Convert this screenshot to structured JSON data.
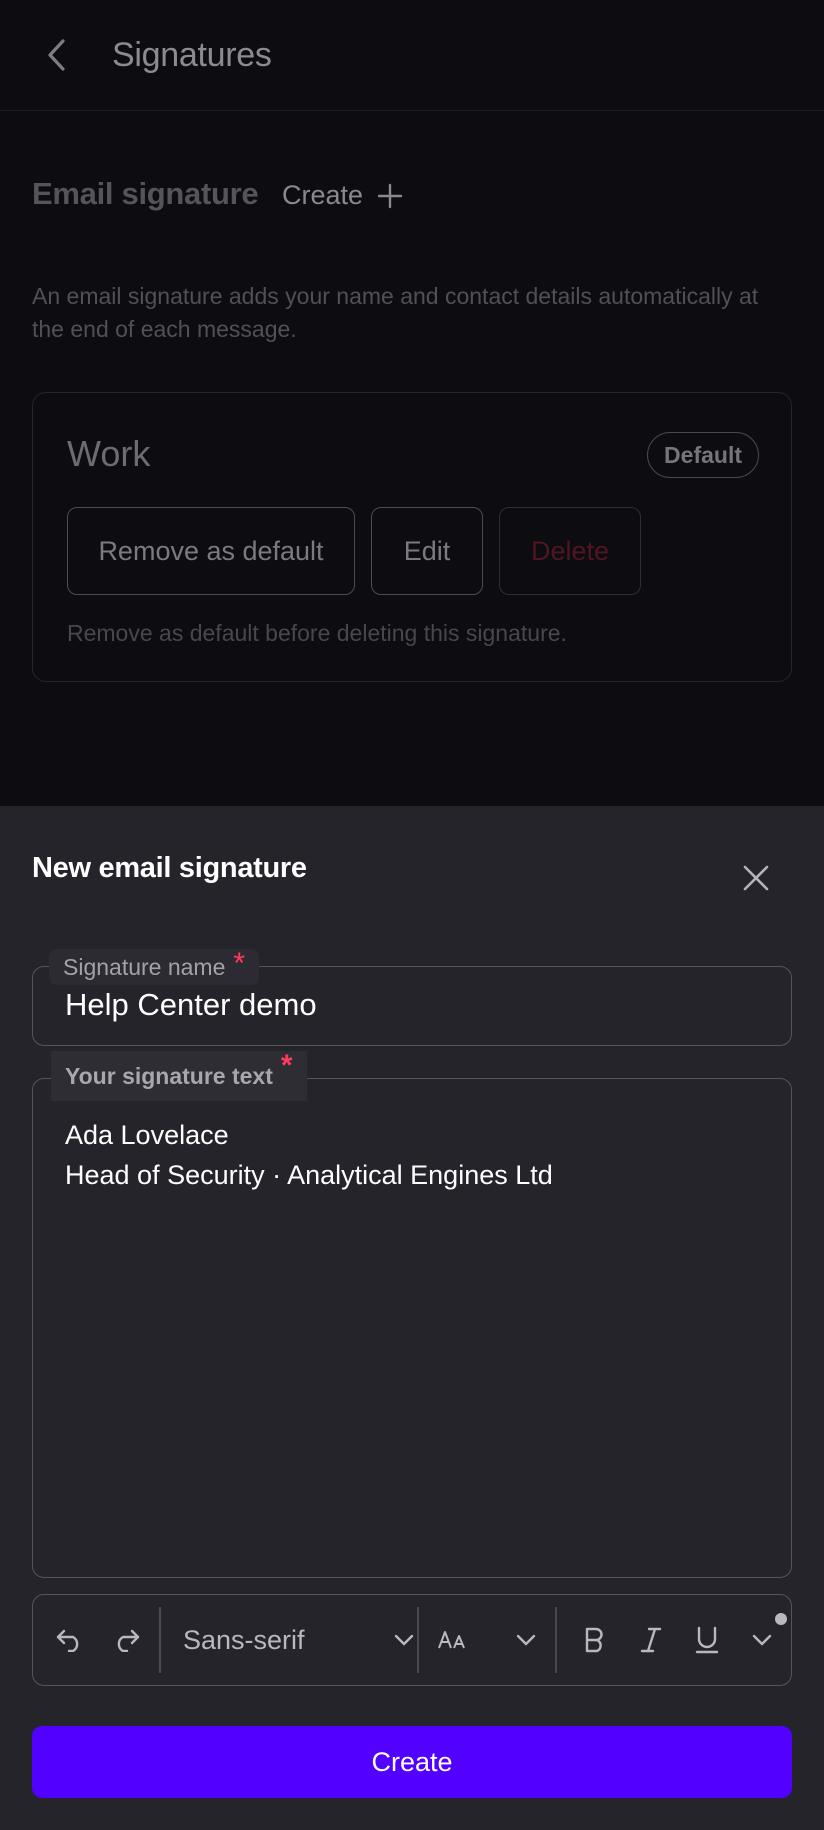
{
  "header": {
    "title": "Signatures"
  },
  "section": {
    "title": "Email signature",
    "create_label": "Create",
    "description": "An email signature adds your name and contact details automatically at the end of each message."
  },
  "signature_card": {
    "name": "Work",
    "badge": "Default",
    "remove_default_label": "Remove as default",
    "edit_label": "Edit",
    "delete_label": "Delete",
    "note": "Remove as default before deleting this signature."
  },
  "sheet": {
    "title": "New email signature",
    "name_field": {
      "label": "Signature name",
      "required_mark": "*",
      "value": "Help Center demo"
    },
    "text_field": {
      "label": "Your signature text",
      "required_mark": "*",
      "lines": [
        "Ada Lovelace",
        "Head of Security · Analytical Engines Ltd"
      ]
    },
    "toolbar": {
      "font": "Sans-serif"
    },
    "submit_label": "Create"
  },
  "colors": {
    "accent": "#5200ff",
    "required": "#ff3b5c",
    "danger": "#4f1522"
  }
}
